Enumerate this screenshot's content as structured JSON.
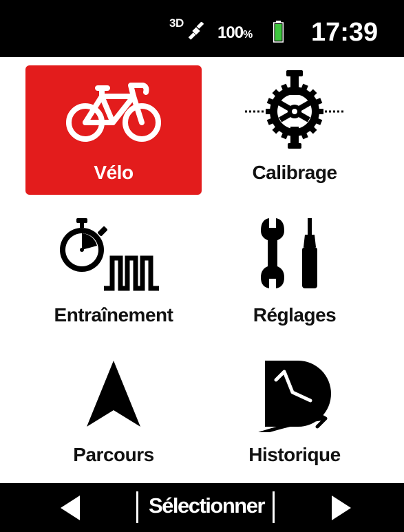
{
  "status_bar": {
    "gps_label": "3D",
    "battery_percent": "100",
    "battery_unit": "%",
    "battery_level": 1.0,
    "battery_color": "#3ec63e",
    "time": "17:39",
    "icons": [
      "satellite-icon",
      "battery-icon"
    ]
  },
  "menu": {
    "accent_color": "#e31c1c",
    "selected_index": 0,
    "items": [
      {
        "label": "Vélo",
        "icon": "bike-icon"
      },
      {
        "label": "Calibrage",
        "icon": "crankset-icon"
      },
      {
        "label": "Entraînement",
        "icon": "stopwatch-interval-icon"
      },
      {
        "label": "Réglages",
        "icon": "tools-icon"
      },
      {
        "label": "Parcours",
        "icon": "navigation-arrow-icon"
      },
      {
        "label": "Historique",
        "icon": "history-clock-icon"
      }
    ]
  },
  "bottom_bar": {
    "select_label": "Sélectionner",
    "icons": [
      "arrow-left-icon",
      "arrow-right-icon"
    ]
  }
}
